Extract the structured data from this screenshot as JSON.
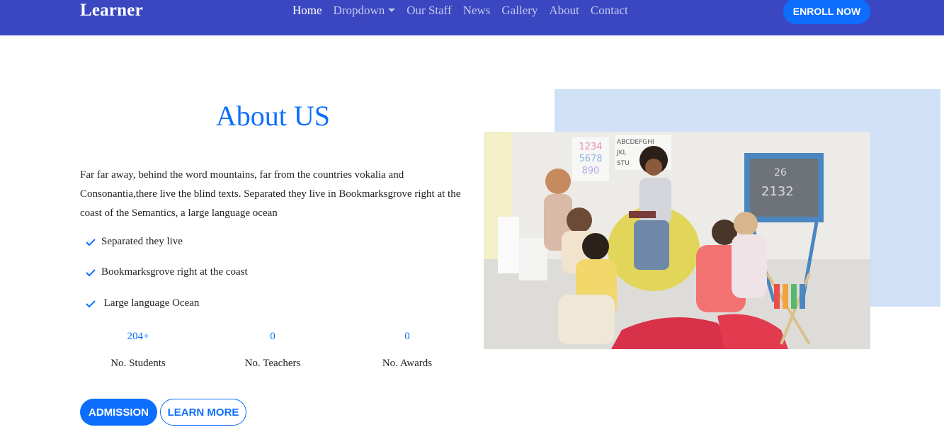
{
  "navbar": {
    "brand": "Learner",
    "links": [
      {
        "label": "Home",
        "active": true
      },
      {
        "label": "Dropdown",
        "active": false,
        "has_caret": true
      },
      {
        "label": "Our Staff",
        "active": false
      },
      {
        "label": "News",
        "active": false
      },
      {
        "label": "Gallery",
        "active": false
      },
      {
        "label": "About",
        "active": false
      },
      {
        "label": "Contact",
        "active": false
      }
    ],
    "enroll_label": "ENROLL NOW"
  },
  "about": {
    "title": "About US",
    "paragraph": "Far far away, behind the word mountains, far from the countries vokalia and Consonantia,there live the blind texts. Separated they live in Bookmarksgrove right at the coast of the Semantics, a large language ocean",
    "checklist": [
      "Separated they live",
      "Bookmarksgrove right at the coast",
      " Large language Ocean"
    ],
    "stats": [
      {
        "value": "204+",
        "label": "No. Students"
      },
      {
        "value": "0",
        "label": "No. Teachers"
      },
      {
        "value": "0",
        "label": "No. Awards"
      }
    ],
    "buttons": {
      "admission": "ADMISSION",
      "learn_more": "LEARN MORE"
    }
  },
  "photo": {
    "description_icon": "classroom-photo",
    "chalkboard_text_1": "26",
    "chalkboard_text_2": "2132",
    "poster_numbers": "1234\n5678\n890",
    "poster_letters": "ABCDEFGHI\nJKL\nSTU"
  },
  "colors": {
    "navbar_bg": "#3a47c1",
    "primary": "#0d6efd",
    "backdrop": "#cfe0f7"
  }
}
